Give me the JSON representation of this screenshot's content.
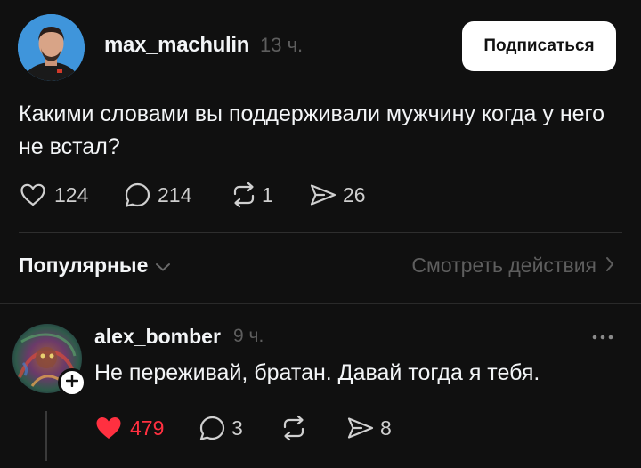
{
  "post": {
    "author": "max_machulin",
    "time": "13 ч.",
    "follow_label": "Подписаться",
    "text": "Какими словами вы поддерживали мужчину когда у него не встал?",
    "likes": "124",
    "comments": "214",
    "reposts": "1",
    "shares": "26"
  },
  "replies_bar": {
    "sort_label": "Популярные",
    "view_activity_label": "Смотреть действия"
  },
  "reply": {
    "author": "alex_bomber",
    "time": "9 ч.",
    "text": "Не переживай, братан. Давай тогда я тебя.",
    "likes": "479",
    "comments": "3",
    "shares": "8",
    "liked": true
  },
  "colors": {
    "background": "#101010",
    "like_active": "#ff3040",
    "muted": "#5e5e5e"
  },
  "icons": [
    "heart-icon",
    "comment-icon",
    "repost-icon",
    "share-icon",
    "chevron-down-icon",
    "chevron-right-icon",
    "more-icon",
    "plus-icon"
  ]
}
